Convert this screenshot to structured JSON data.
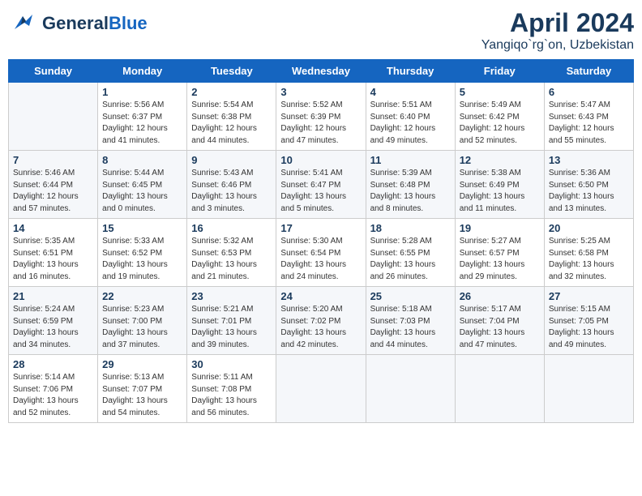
{
  "header": {
    "logo_general": "General",
    "logo_blue": "Blue",
    "title": "April 2024",
    "subtitle": "Yangiqo`rg`on, Uzbekistan"
  },
  "calendar": {
    "days_of_week": [
      "Sunday",
      "Monday",
      "Tuesday",
      "Wednesday",
      "Thursday",
      "Friday",
      "Saturday"
    ],
    "weeks": [
      [
        {
          "day": "",
          "info": ""
        },
        {
          "day": "1",
          "info": "Sunrise: 5:56 AM\nSunset: 6:37 PM\nDaylight: 12 hours\nand 41 minutes."
        },
        {
          "day": "2",
          "info": "Sunrise: 5:54 AM\nSunset: 6:38 PM\nDaylight: 12 hours\nand 44 minutes."
        },
        {
          "day": "3",
          "info": "Sunrise: 5:52 AM\nSunset: 6:39 PM\nDaylight: 12 hours\nand 47 minutes."
        },
        {
          "day": "4",
          "info": "Sunrise: 5:51 AM\nSunset: 6:40 PM\nDaylight: 12 hours\nand 49 minutes."
        },
        {
          "day": "5",
          "info": "Sunrise: 5:49 AM\nSunset: 6:42 PM\nDaylight: 12 hours\nand 52 minutes."
        },
        {
          "day": "6",
          "info": "Sunrise: 5:47 AM\nSunset: 6:43 PM\nDaylight: 12 hours\nand 55 minutes."
        }
      ],
      [
        {
          "day": "7",
          "info": "Sunrise: 5:46 AM\nSunset: 6:44 PM\nDaylight: 12 hours\nand 57 minutes."
        },
        {
          "day": "8",
          "info": "Sunrise: 5:44 AM\nSunset: 6:45 PM\nDaylight: 13 hours\nand 0 minutes."
        },
        {
          "day": "9",
          "info": "Sunrise: 5:43 AM\nSunset: 6:46 PM\nDaylight: 13 hours\nand 3 minutes."
        },
        {
          "day": "10",
          "info": "Sunrise: 5:41 AM\nSunset: 6:47 PM\nDaylight: 13 hours\nand 5 minutes."
        },
        {
          "day": "11",
          "info": "Sunrise: 5:39 AM\nSunset: 6:48 PM\nDaylight: 13 hours\nand 8 minutes."
        },
        {
          "day": "12",
          "info": "Sunrise: 5:38 AM\nSunset: 6:49 PM\nDaylight: 13 hours\nand 11 minutes."
        },
        {
          "day": "13",
          "info": "Sunrise: 5:36 AM\nSunset: 6:50 PM\nDaylight: 13 hours\nand 13 minutes."
        }
      ],
      [
        {
          "day": "14",
          "info": "Sunrise: 5:35 AM\nSunset: 6:51 PM\nDaylight: 13 hours\nand 16 minutes."
        },
        {
          "day": "15",
          "info": "Sunrise: 5:33 AM\nSunset: 6:52 PM\nDaylight: 13 hours\nand 19 minutes."
        },
        {
          "day": "16",
          "info": "Sunrise: 5:32 AM\nSunset: 6:53 PM\nDaylight: 13 hours\nand 21 minutes."
        },
        {
          "day": "17",
          "info": "Sunrise: 5:30 AM\nSunset: 6:54 PM\nDaylight: 13 hours\nand 24 minutes."
        },
        {
          "day": "18",
          "info": "Sunrise: 5:28 AM\nSunset: 6:55 PM\nDaylight: 13 hours\nand 26 minutes."
        },
        {
          "day": "19",
          "info": "Sunrise: 5:27 AM\nSunset: 6:57 PM\nDaylight: 13 hours\nand 29 minutes."
        },
        {
          "day": "20",
          "info": "Sunrise: 5:25 AM\nSunset: 6:58 PM\nDaylight: 13 hours\nand 32 minutes."
        }
      ],
      [
        {
          "day": "21",
          "info": "Sunrise: 5:24 AM\nSunset: 6:59 PM\nDaylight: 13 hours\nand 34 minutes."
        },
        {
          "day": "22",
          "info": "Sunrise: 5:23 AM\nSunset: 7:00 PM\nDaylight: 13 hours\nand 37 minutes."
        },
        {
          "day": "23",
          "info": "Sunrise: 5:21 AM\nSunset: 7:01 PM\nDaylight: 13 hours\nand 39 minutes."
        },
        {
          "day": "24",
          "info": "Sunrise: 5:20 AM\nSunset: 7:02 PM\nDaylight: 13 hours\nand 42 minutes."
        },
        {
          "day": "25",
          "info": "Sunrise: 5:18 AM\nSunset: 7:03 PM\nDaylight: 13 hours\nand 44 minutes."
        },
        {
          "day": "26",
          "info": "Sunrise: 5:17 AM\nSunset: 7:04 PM\nDaylight: 13 hours\nand 47 minutes."
        },
        {
          "day": "27",
          "info": "Sunrise: 5:15 AM\nSunset: 7:05 PM\nDaylight: 13 hours\nand 49 minutes."
        }
      ],
      [
        {
          "day": "28",
          "info": "Sunrise: 5:14 AM\nSunset: 7:06 PM\nDaylight: 13 hours\nand 52 minutes."
        },
        {
          "day": "29",
          "info": "Sunrise: 5:13 AM\nSunset: 7:07 PM\nDaylight: 13 hours\nand 54 minutes."
        },
        {
          "day": "30",
          "info": "Sunrise: 5:11 AM\nSunset: 7:08 PM\nDaylight: 13 hours\nand 56 minutes."
        },
        {
          "day": "",
          "info": ""
        },
        {
          "day": "",
          "info": ""
        },
        {
          "day": "",
          "info": ""
        },
        {
          "day": "",
          "info": ""
        }
      ]
    ]
  }
}
